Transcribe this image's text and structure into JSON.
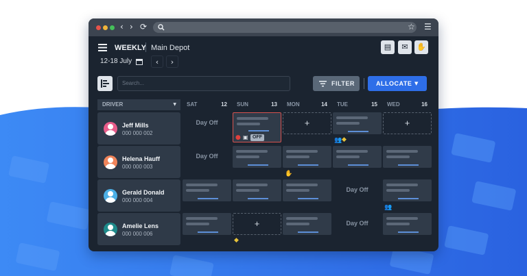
{
  "browser": {
    "back_icon": "chevron-left-icon",
    "forward_icon": "chevron-right-icon",
    "reload_icon": "reload-icon",
    "search_icon": "search-icon",
    "star_icon": "star-icon",
    "menu_icon": "hamburger-icon",
    "traffic_lights": [
      "#e8534a",
      "#f1b53a",
      "#45c05a"
    ]
  },
  "header": {
    "view_label": "WEEKLY",
    "location": "Main Depot",
    "date_range": "12-18 July",
    "calendar_icon": "calendar-icon",
    "prev_icon": "chevron-left-icon",
    "next_icon": "chevron-right-icon",
    "actions": [
      "document-icon",
      "mail-icon",
      "hand-icon"
    ]
  },
  "toolbar": {
    "search_placeholder": "Search...",
    "filter_label": "FILTER",
    "allocate_label": "ALLOCATE"
  },
  "grid": {
    "driver_header": "DRIVER",
    "days": [
      {
        "name": "SAT",
        "num": "12"
      },
      {
        "name": "SUN",
        "num": "13"
      },
      {
        "name": "MON",
        "num": "14"
      },
      {
        "name": "TUE",
        "num": "15"
      },
      {
        "name": "WED",
        "num": "16"
      }
    ],
    "drivers": [
      {
        "name": "Jeff Mills",
        "phone": "000 000 002",
        "avatar_color": "#e85c8a"
      },
      {
        "name": "Helena Hauff",
        "phone": "000 000 003",
        "avatar_color": "#f0845a"
      },
      {
        "name": "Gerald Donald",
        "phone": "000 000 004",
        "avatar_color": "#4cb0e6"
      },
      {
        "name": "Amelie Lens",
        "phone": "000 000 006",
        "avatar_color": "#1e8a8a"
      }
    ],
    "day_off_label": "Day Off",
    "add_label": "+",
    "off_badge": "OFF"
  },
  "colors": {
    "accent": "#2e6ee8",
    "background_blue": "#3a7ff0",
    "warning_red": "#e0403c",
    "tag_yellow": "#e6c23a",
    "people_teal": "#2bb0c4",
    "hand_purple": "#8a6ae0"
  }
}
